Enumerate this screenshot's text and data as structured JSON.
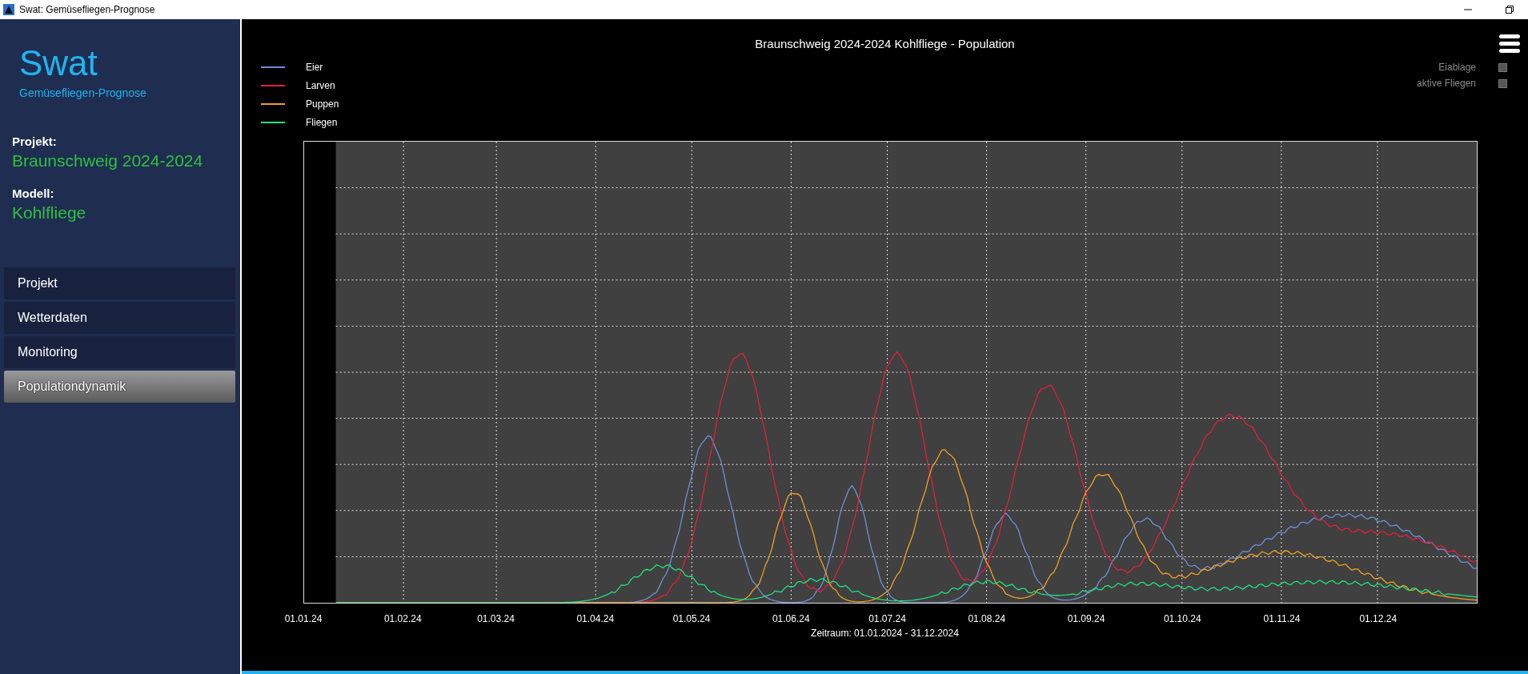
{
  "window": {
    "title": "Swat: Gemüsefliegen-Prognose"
  },
  "sidebar": {
    "app_name": "Swat",
    "app_subtitle": "Gemüsefliegen-Prognose",
    "project_label": "Projekt:",
    "project_value": "Braunschweig 2024-2024",
    "model_label": "Modell:",
    "model_value": "Kohlfliege",
    "items": [
      {
        "label": "Projekt",
        "selected": false
      },
      {
        "label": "Wetterdaten",
        "selected": false
      },
      {
        "label": "Monitoring",
        "selected": false
      },
      {
        "label": "Populationdynamik",
        "selected": true
      }
    ]
  },
  "chart": {
    "title": "Braunschweig 2024-2024 Kohlfliege - Population",
    "legend": [
      {
        "label": "Eier",
        "color": "#6f8fd8"
      },
      {
        "label": "Larven",
        "color": "#e0203c"
      },
      {
        "label": "Puppen",
        "color": "#f0a020"
      },
      {
        "label": "Fliegen",
        "color": "#20e080"
      }
    ],
    "toggles": [
      {
        "label": "Eiablage",
        "checked": false
      },
      {
        "label": "aktive Fliegen",
        "checked": false
      }
    ],
    "x_labels": [
      "01.01.24",
      "01.02.24",
      "01.03.24",
      "01.04.24",
      "01.05.24",
      "01.06.24",
      "01.07.24",
      "01.08.24",
      "01.09.24",
      "01.10.24",
      "01.11.24",
      "01.12.24"
    ],
    "xlabel": "Zeitraum: 01.01.2024 - 31.12.2024"
  }
}
